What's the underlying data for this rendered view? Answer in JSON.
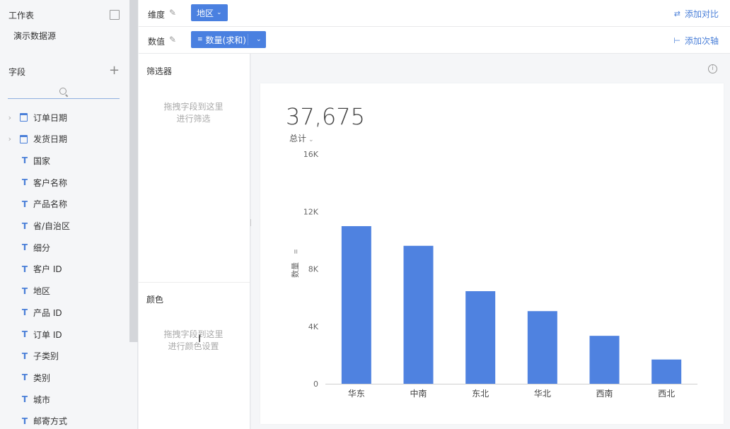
{
  "sidebar": {
    "workbook_title": "工作表",
    "datasource": "演示数据源",
    "fields_title": "字段",
    "fields": [
      {
        "label": "订单日期",
        "type": "date",
        "expandable": true
      },
      {
        "label": "发货日期",
        "type": "date",
        "expandable": true
      },
      {
        "label": "国家",
        "type": "text"
      },
      {
        "label": "客户名称",
        "type": "text"
      },
      {
        "label": "产品名称",
        "type": "text"
      },
      {
        "label": "省/自治区",
        "type": "text"
      },
      {
        "label": "细分",
        "type": "text"
      },
      {
        "label": "客户 ID",
        "type": "text"
      },
      {
        "label": "地区",
        "type": "text"
      },
      {
        "label": "产品 ID",
        "type": "text"
      },
      {
        "label": "订单 ID",
        "type": "text"
      },
      {
        "label": "子类别",
        "type": "text"
      },
      {
        "label": "类别",
        "type": "text"
      },
      {
        "label": "城市",
        "type": "text"
      },
      {
        "label": "邮寄方式",
        "type": "text"
      }
    ]
  },
  "shelves": {
    "dimension_label": "维度",
    "dimension_chip": "地区",
    "add_compare": "添加对比",
    "measure_label": "数值",
    "measure_chip": "数量(求和)",
    "add_secondary_axis": "添加次轴"
  },
  "config": {
    "filter_title": "筛选器",
    "filter_hint_1": "拖拽字段到这里",
    "filter_hint_2": "进行筛选",
    "color_title": "颜色",
    "color_hint_1": "拖拽字段到这里",
    "color_hint_2": "进行颜色设置"
  },
  "summary": {
    "total_value": "37,675",
    "total_label": "总计"
  },
  "colors": {
    "accent": "#4a80e0",
    "bar": "#4f82e0"
  },
  "chart_data": {
    "type": "bar",
    "categories": [
      "华东",
      "中南",
      "东北",
      "华北",
      "西南",
      "西北"
    ],
    "values": [
      10980,
      9610,
      6450,
      5060,
      3340,
      1690
    ],
    "ylabel": "数量",
    "ylim": [
      0,
      16000
    ],
    "yticks": [
      0,
      4000,
      8000,
      12000,
      16000
    ],
    "ytick_labels": [
      "0",
      "4K",
      "8K",
      "12K",
      "16K"
    ],
    "grid": false
  }
}
